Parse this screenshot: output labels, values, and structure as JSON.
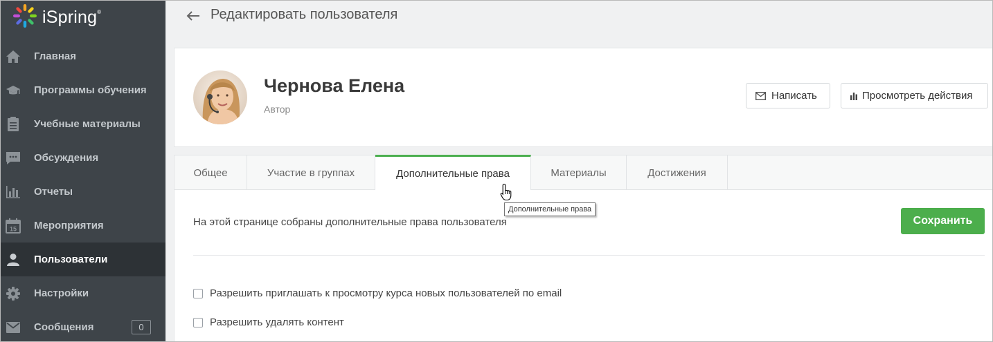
{
  "app": {
    "name": "iSpring"
  },
  "sidebar": {
    "items": [
      {
        "label": "Главная",
        "icon": "home-icon"
      },
      {
        "label": "Программы обучения",
        "icon": "graduation-cap-icon"
      },
      {
        "label": "Учебные материалы",
        "icon": "clipboard-icon"
      },
      {
        "label": "Обсуждения",
        "icon": "chat-icon"
      },
      {
        "label": "Отчеты",
        "icon": "bar-chart-icon"
      },
      {
        "label": "Мероприятия",
        "icon": "calendar-icon"
      },
      {
        "label": "Пользователи",
        "icon": "user-icon",
        "active": true
      },
      {
        "label": "Настройки",
        "icon": "gear-icon"
      },
      {
        "label": "Сообщения",
        "icon": "envelope-icon",
        "badge": "0"
      }
    ]
  },
  "header": {
    "title": "Редактировать пользователя"
  },
  "profile": {
    "name": "Чернова Елена",
    "role": "Автор",
    "write_label": "Написать",
    "actions_label": "Просмотреть действия"
  },
  "tabs": [
    {
      "label": "Общее"
    },
    {
      "label": "Участие в группах"
    },
    {
      "label": "Дополнительные права",
      "active": true
    },
    {
      "label": "Материалы"
    },
    {
      "label": "Достижения"
    }
  ],
  "panel": {
    "description": "На этой странице собраны дополнительные права пользователя",
    "save_label": "Сохранить",
    "checkboxes": [
      {
        "label": "Разрешить приглашать к просмотру курса новых пользователей по email",
        "checked": false
      },
      {
        "label": "Разрешить удалять контент",
        "checked": false
      }
    ]
  },
  "tooltip": {
    "text": "Дополнительные права"
  },
  "colors": {
    "sidebar": "#3e4449",
    "accent": "#4caf50",
    "active_nav": "#2d3236"
  }
}
